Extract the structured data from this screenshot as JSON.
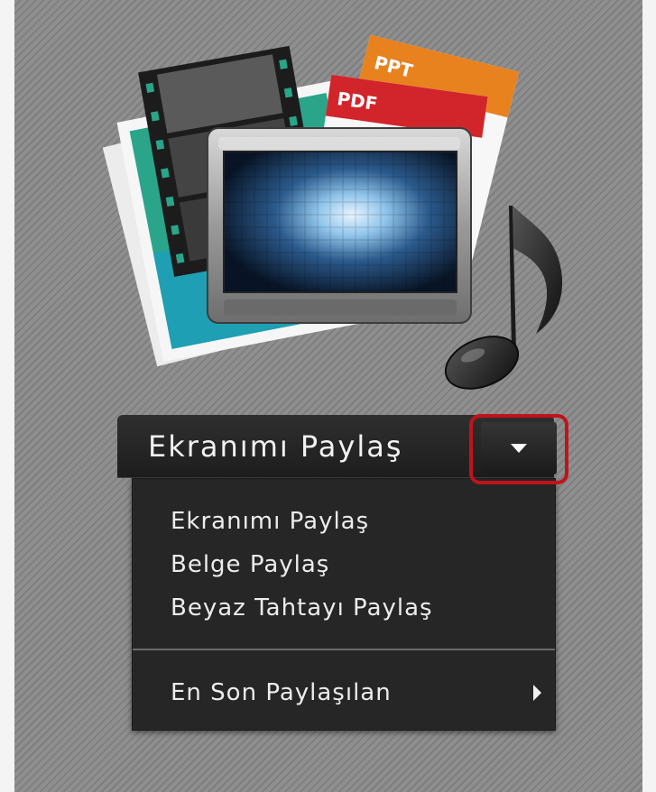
{
  "pod": {
    "share_button": {
      "label": "Ekranımı Paylaş"
    },
    "illustration": {
      "ppt_label": "PPT",
      "pdf_label": "PDF"
    },
    "menu": {
      "items": [
        {
          "label": "Ekranımı Paylaş"
        },
        {
          "label": "Belge Paylaş"
        },
        {
          "label": "Beyaz Tahtayı Paylaş"
        }
      ],
      "submenu": {
        "label": "En Son Paylaşılan"
      }
    }
  },
  "colors": {
    "highlight": "#c0141a",
    "ppt": "#e8821f",
    "pdf": "#d1252b"
  }
}
